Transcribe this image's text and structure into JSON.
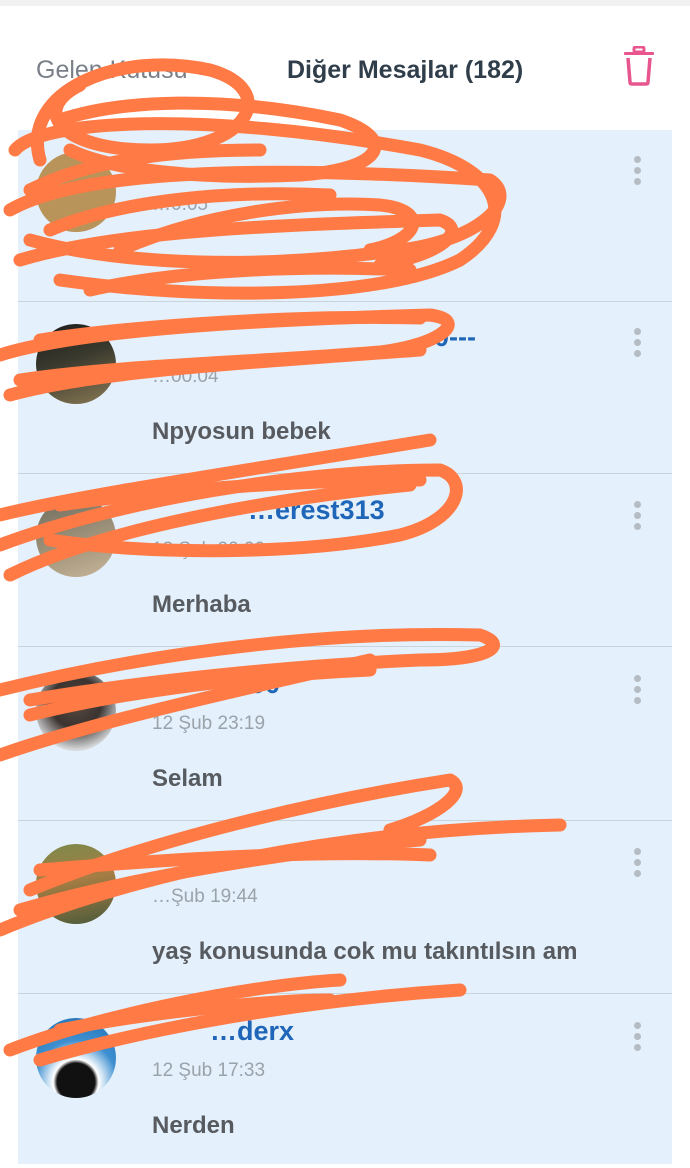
{
  "header": {
    "inbox_tab": "Gelen Kutusu",
    "other_tab": "Diğer Mesajlar (182)",
    "trash_icon": "trash-icon",
    "trash_color": "#e8568f"
  },
  "messages": [
    {
      "username": "",
      "time": "…0:05",
      "text": ""
    },
    {
      "username": "…-0---",
      "time": "…00:04",
      "text": "Npyosun bebek"
    },
    {
      "username": "…erest313",
      "time": "13 Şub 00:00",
      "text": "Merhaba"
    },
    {
      "username": "…00",
      "time": "12 Şub 23:19",
      "text": "Selam"
    },
    {
      "username": "",
      "time": "…Şub 19:44",
      "text": "yaş konusunda cok mu takıntılsın am"
    },
    {
      "username": "…derx",
      "time": "12 Şub 17:33",
      "text": "Nerden"
    }
  ],
  "colors": {
    "list_background": "#e4f0fb",
    "username": "#1f66b8",
    "scribble": "#ff7a45"
  },
  "icons": {
    "more": "more-vertical-icon"
  }
}
